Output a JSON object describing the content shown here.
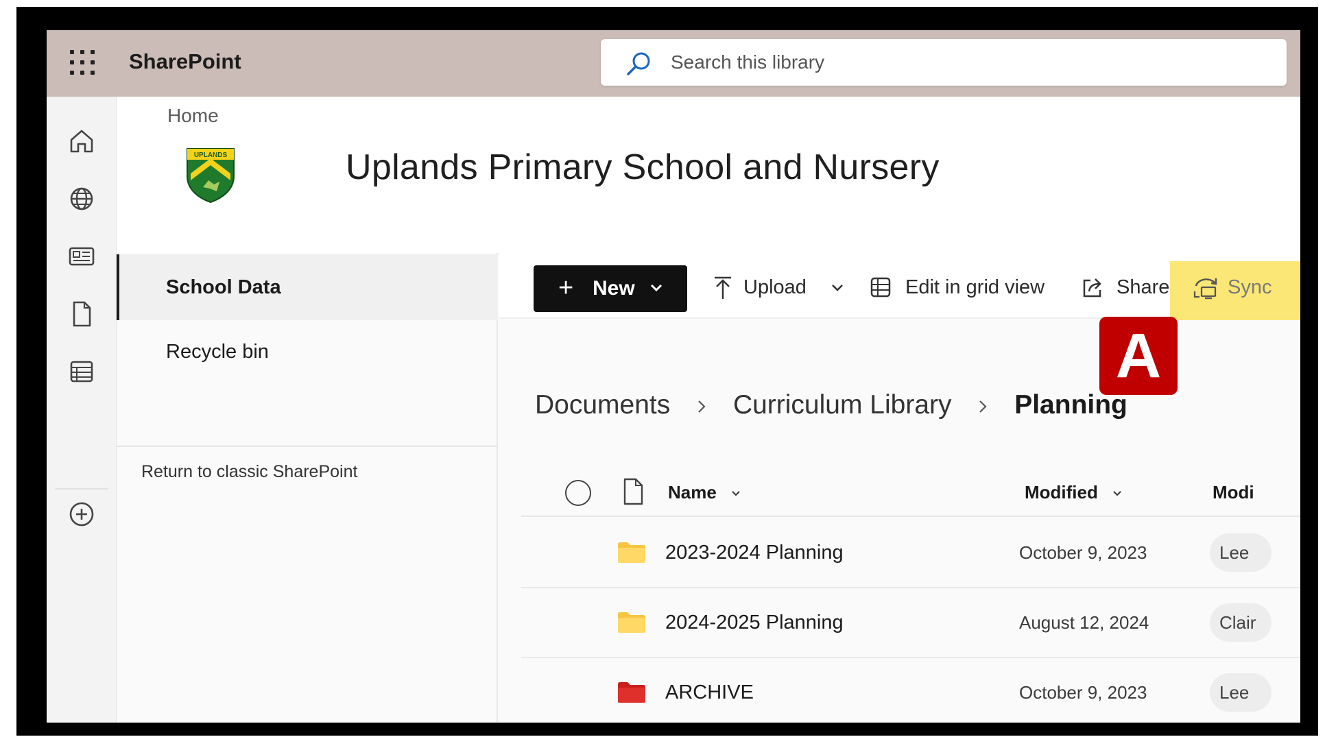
{
  "suite_bar": {
    "app_name": "SharePoint",
    "search_placeholder": "Search this library"
  },
  "site": {
    "home_link": "Home",
    "logo_text": "UPLANDS",
    "title": "Uplands Primary School and Nursery"
  },
  "left_nav": {
    "items": [
      {
        "label": "School Data",
        "selected": true
      },
      {
        "label": "Recycle bin",
        "selected": false
      }
    ],
    "classic_link": "Return to classic SharePoint"
  },
  "command_bar": {
    "new_label": "New",
    "upload_label": "Upload",
    "grid_label": "Edit in grid view",
    "share_label": "Share",
    "sync_label": "Sync",
    "more_label": "..."
  },
  "callout": {
    "label": "A",
    "color": "#c00000",
    "highlight_color": "#fbe775"
  },
  "breadcrumb": [
    "Documents",
    "Curriculum Library",
    "Planning"
  ],
  "list": {
    "columns": {
      "name": "Name",
      "modified": "Modified",
      "modified_by": "Modi"
    },
    "rows": [
      {
        "name": "2023-2024 Planning",
        "modified": "October 9, 2023",
        "modified_by": "Lee",
        "folder_color": "#f8c542"
      },
      {
        "name": "2024-2025 Planning",
        "modified": "August 12, 2024",
        "modified_by": "Clair",
        "folder_color": "#f8c542"
      },
      {
        "name": "ARCHIVE",
        "modified": "October 9, 2023",
        "modified_by": "Lee",
        "folder_color": "#e0302b"
      }
    ]
  },
  "icons": {
    "waffle": "app-launcher-icon",
    "search": "search-icon",
    "rail": [
      "home-icon",
      "globe-icon",
      "news-icon",
      "file-icon",
      "list-icon",
      "add-circle-icon"
    ]
  }
}
